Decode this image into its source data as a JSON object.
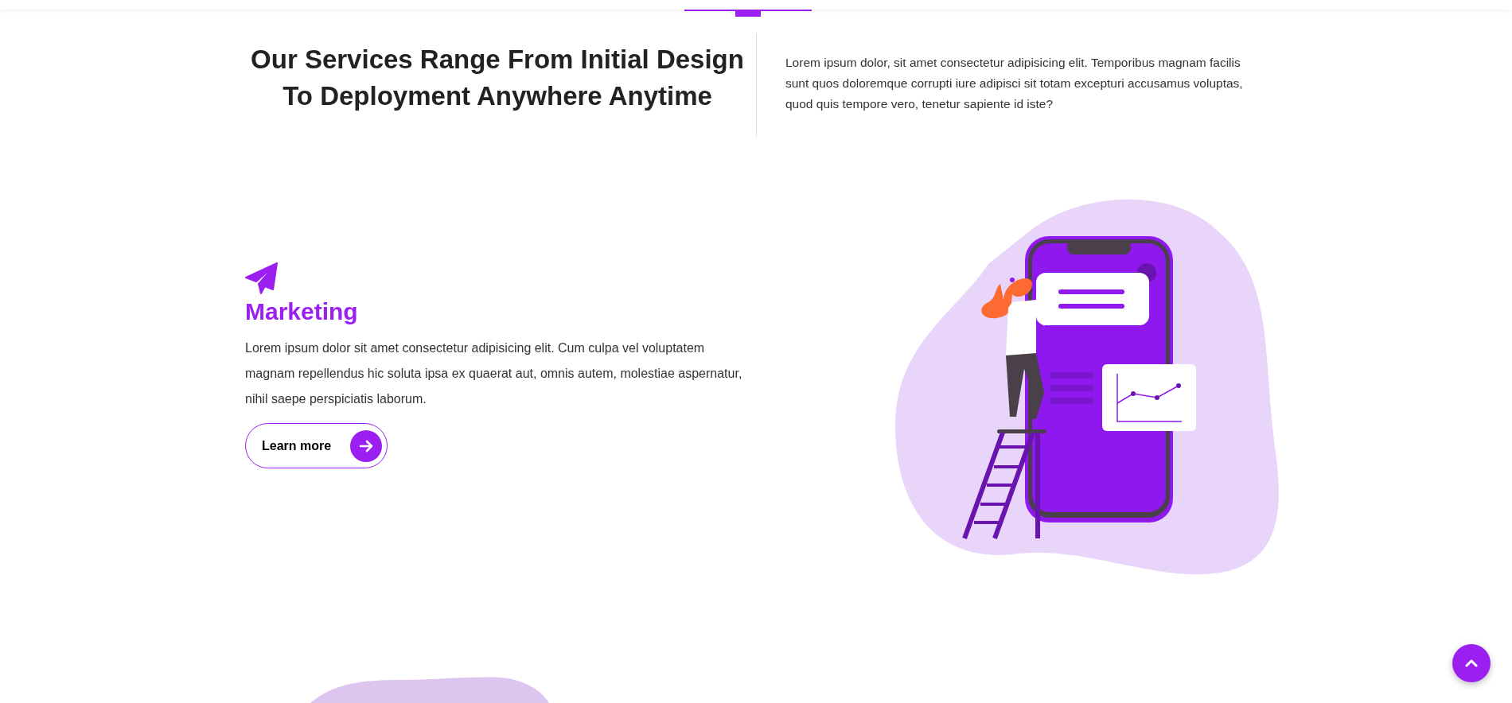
{
  "intro": {
    "heading": "Our Services Range From Initial Design To Deployment Anywhere Anytime",
    "text": "Lorem ipsum dolor, sit amet consectetur adipisicing elit. Temporibus magnam facilis sunt quos doloremque corrupti iure adipisci sit totam excepturi accusamus voluptas, quod quis tempore vero, tenetur sapiente id iste?"
  },
  "service": {
    "title": "Marketing",
    "text": "Lorem ipsum dolor sit amet consectetur adipisicing elit. Cum culpa vel voluptatem magnam repellendus hic soluta ipsa ex quaerat aut, omnis autem, molestiae aspernatur, nihil saepe perspiciatis laborum.",
    "button": "Learn more"
  }
}
